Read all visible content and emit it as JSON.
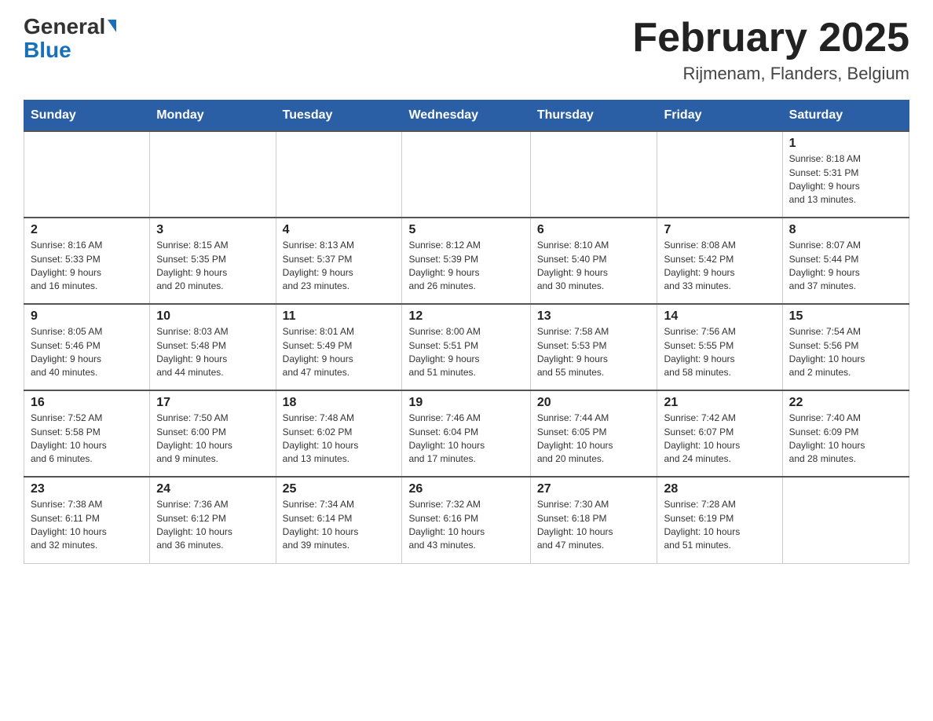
{
  "header": {
    "logo_general": "General",
    "logo_blue": "Blue",
    "month_title": "February 2025",
    "location": "Rijmenam, Flanders, Belgium"
  },
  "days_of_week": [
    "Sunday",
    "Monday",
    "Tuesday",
    "Wednesday",
    "Thursday",
    "Friday",
    "Saturday"
  ],
  "weeks": [
    {
      "days": [
        {
          "num": "",
          "info": ""
        },
        {
          "num": "",
          "info": ""
        },
        {
          "num": "",
          "info": ""
        },
        {
          "num": "",
          "info": ""
        },
        {
          "num": "",
          "info": ""
        },
        {
          "num": "",
          "info": ""
        },
        {
          "num": "1",
          "info": "Sunrise: 8:18 AM\nSunset: 5:31 PM\nDaylight: 9 hours\nand 13 minutes."
        }
      ]
    },
    {
      "days": [
        {
          "num": "2",
          "info": "Sunrise: 8:16 AM\nSunset: 5:33 PM\nDaylight: 9 hours\nand 16 minutes."
        },
        {
          "num": "3",
          "info": "Sunrise: 8:15 AM\nSunset: 5:35 PM\nDaylight: 9 hours\nand 20 minutes."
        },
        {
          "num": "4",
          "info": "Sunrise: 8:13 AM\nSunset: 5:37 PM\nDaylight: 9 hours\nand 23 minutes."
        },
        {
          "num": "5",
          "info": "Sunrise: 8:12 AM\nSunset: 5:39 PM\nDaylight: 9 hours\nand 26 minutes."
        },
        {
          "num": "6",
          "info": "Sunrise: 8:10 AM\nSunset: 5:40 PM\nDaylight: 9 hours\nand 30 minutes."
        },
        {
          "num": "7",
          "info": "Sunrise: 8:08 AM\nSunset: 5:42 PM\nDaylight: 9 hours\nand 33 minutes."
        },
        {
          "num": "8",
          "info": "Sunrise: 8:07 AM\nSunset: 5:44 PM\nDaylight: 9 hours\nand 37 minutes."
        }
      ]
    },
    {
      "days": [
        {
          "num": "9",
          "info": "Sunrise: 8:05 AM\nSunset: 5:46 PM\nDaylight: 9 hours\nand 40 minutes."
        },
        {
          "num": "10",
          "info": "Sunrise: 8:03 AM\nSunset: 5:48 PM\nDaylight: 9 hours\nand 44 minutes."
        },
        {
          "num": "11",
          "info": "Sunrise: 8:01 AM\nSunset: 5:49 PM\nDaylight: 9 hours\nand 47 minutes."
        },
        {
          "num": "12",
          "info": "Sunrise: 8:00 AM\nSunset: 5:51 PM\nDaylight: 9 hours\nand 51 minutes."
        },
        {
          "num": "13",
          "info": "Sunrise: 7:58 AM\nSunset: 5:53 PM\nDaylight: 9 hours\nand 55 minutes."
        },
        {
          "num": "14",
          "info": "Sunrise: 7:56 AM\nSunset: 5:55 PM\nDaylight: 9 hours\nand 58 minutes."
        },
        {
          "num": "15",
          "info": "Sunrise: 7:54 AM\nSunset: 5:56 PM\nDaylight: 10 hours\nand 2 minutes."
        }
      ]
    },
    {
      "days": [
        {
          "num": "16",
          "info": "Sunrise: 7:52 AM\nSunset: 5:58 PM\nDaylight: 10 hours\nand 6 minutes."
        },
        {
          "num": "17",
          "info": "Sunrise: 7:50 AM\nSunset: 6:00 PM\nDaylight: 10 hours\nand 9 minutes."
        },
        {
          "num": "18",
          "info": "Sunrise: 7:48 AM\nSunset: 6:02 PM\nDaylight: 10 hours\nand 13 minutes."
        },
        {
          "num": "19",
          "info": "Sunrise: 7:46 AM\nSunset: 6:04 PM\nDaylight: 10 hours\nand 17 minutes."
        },
        {
          "num": "20",
          "info": "Sunrise: 7:44 AM\nSunset: 6:05 PM\nDaylight: 10 hours\nand 20 minutes."
        },
        {
          "num": "21",
          "info": "Sunrise: 7:42 AM\nSunset: 6:07 PM\nDaylight: 10 hours\nand 24 minutes."
        },
        {
          "num": "22",
          "info": "Sunrise: 7:40 AM\nSunset: 6:09 PM\nDaylight: 10 hours\nand 28 minutes."
        }
      ]
    },
    {
      "days": [
        {
          "num": "23",
          "info": "Sunrise: 7:38 AM\nSunset: 6:11 PM\nDaylight: 10 hours\nand 32 minutes."
        },
        {
          "num": "24",
          "info": "Sunrise: 7:36 AM\nSunset: 6:12 PM\nDaylight: 10 hours\nand 36 minutes."
        },
        {
          "num": "25",
          "info": "Sunrise: 7:34 AM\nSunset: 6:14 PM\nDaylight: 10 hours\nand 39 minutes."
        },
        {
          "num": "26",
          "info": "Sunrise: 7:32 AM\nSunset: 6:16 PM\nDaylight: 10 hours\nand 43 minutes."
        },
        {
          "num": "27",
          "info": "Sunrise: 7:30 AM\nSunset: 6:18 PM\nDaylight: 10 hours\nand 47 minutes."
        },
        {
          "num": "28",
          "info": "Sunrise: 7:28 AM\nSunset: 6:19 PM\nDaylight: 10 hours\nand 51 minutes."
        },
        {
          "num": "",
          "info": ""
        }
      ]
    }
  ]
}
